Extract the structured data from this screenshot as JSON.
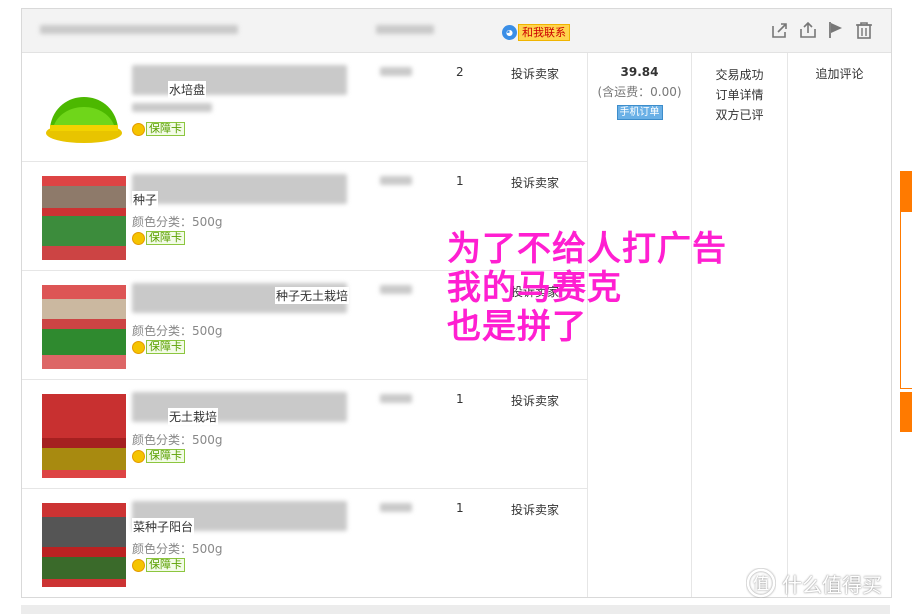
{
  "header": {
    "contact_label": "和我联系",
    "contact_icon": "chat-bubble-icon",
    "icons": [
      "share-icon",
      "upload-icon",
      "flag-icon",
      "trash-icon"
    ]
  },
  "items": [
    {
      "name_fragment": "水培盘",
      "attr": "",
      "badge": "保障卡",
      "qty": "2",
      "action": "投诉卖家"
    },
    {
      "name_fragment": "种子",
      "attr": "颜色分类：500g",
      "badge": "保障卡",
      "qty": "1",
      "action": "投诉卖家"
    },
    {
      "name_fragment": "种子无土栽培",
      "attr": "颜色分类：500g",
      "badge": "保障卡",
      "qty": "",
      "action": "投诉卖家"
    },
    {
      "name_fragment": "无土栽培",
      "attr": "颜色分类：500g",
      "badge": "保障卡",
      "qty": "1",
      "action": "投诉卖家"
    },
    {
      "name_fragment": "菜种子阳台",
      "attr": "颜色分类：500g",
      "badge": "保障卡",
      "qty": "1",
      "action": "投诉卖家"
    }
  ],
  "order": {
    "total": "39.84",
    "shipping": "(含运费：0.00)",
    "mobile_tag": "手机订单",
    "status": [
      "交易成功",
      "订单详情",
      "双方已评"
    ],
    "review": "追加评论"
  },
  "overlay_text": [
    "为了不给人打广告",
    "我的马赛克",
    "也是拼了"
  ],
  "watermark": "什么值得买",
  "colors": {
    "overlay": "#ff1fd1",
    "side_tab": "#ff7a00",
    "badge_green": "#5aa000"
  }
}
